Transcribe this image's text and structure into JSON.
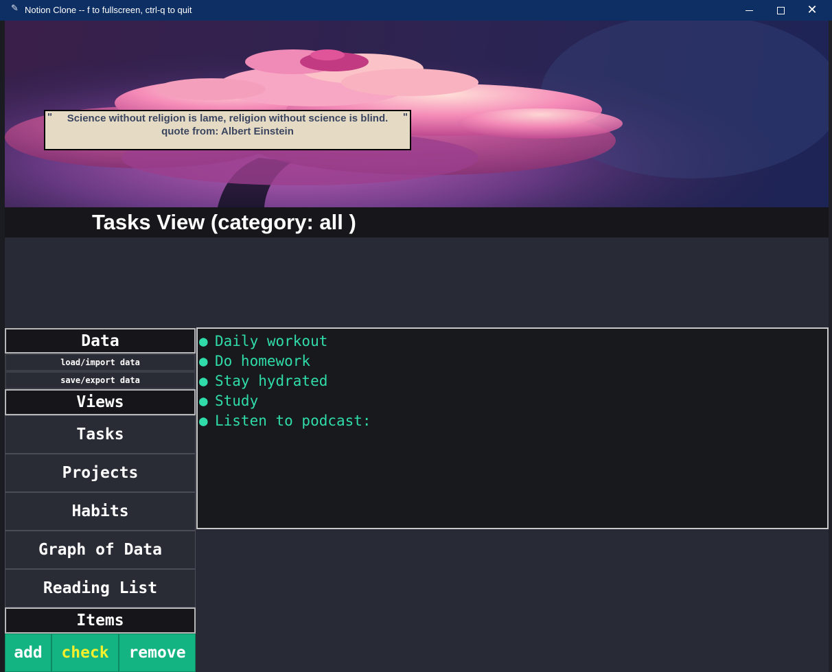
{
  "window": {
    "title": "Notion Clone -- f to fullscreen, ctrl-q to quit",
    "controls": {
      "minimize": "minimize",
      "maximize": "maximize",
      "close": "✕"
    }
  },
  "banner": {
    "quote_open": "\"",
    "quote_text": "Science without religion is lame, religion without science is blind.",
    "quote_close": "\"",
    "quote_author": "quote from: Albert Einstein"
  },
  "header": {
    "title": "Tasks View (category: all )"
  },
  "sidebar": {
    "data_heading": "Data",
    "load_label": "load/import data",
    "save_label": "save/export data",
    "views_heading": "Views",
    "views": [
      "Tasks",
      "Projects",
      "Habits",
      "Graph of Data",
      "Reading List"
    ],
    "items_heading": "Items",
    "actions": {
      "add": "add",
      "check": "check",
      "remove": "remove"
    }
  },
  "tasks": {
    "bullet": "●",
    "items": [
      "Daily workout",
      "Do homework",
      "Stay hydrated",
      "Study",
      "Listen to podcast:"
    ]
  },
  "colors": {
    "task_text": "#30dcaa",
    "action_button_bg": "#14b482",
    "check_label": "#f5ef2c",
    "app_bg": "#282a36",
    "titlebar_bg": "#0e2f63"
  }
}
